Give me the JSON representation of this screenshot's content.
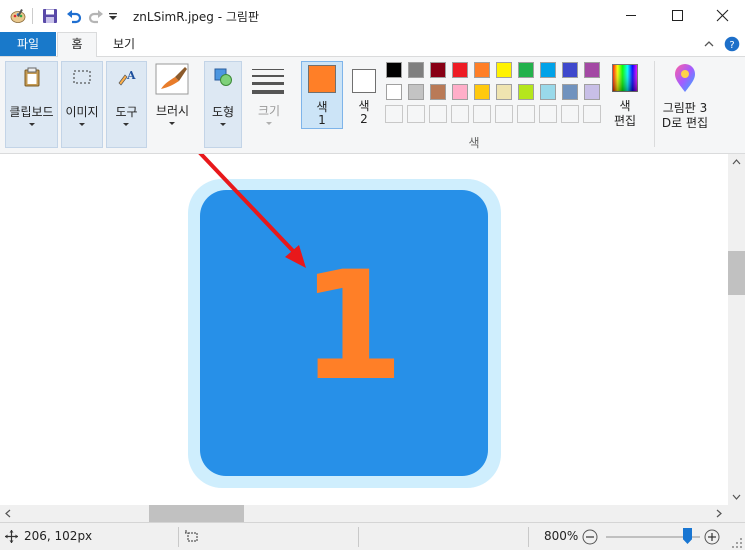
{
  "title_bar": {
    "title": "znLSimR.jpeg - 그림판",
    "icons": [
      "paint-app-icon",
      "save-icon",
      "undo-icon",
      "redo-icon",
      "customize-qat-icon"
    ],
    "window_controls": [
      "minimize-icon",
      "maximize-icon",
      "close-icon"
    ]
  },
  "menu": {
    "file_label": "파일",
    "tabs": [
      {
        "label": "홈",
        "active": true
      },
      {
        "label": "보기",
        "active": false
      }
    ]
  },
  "ribbon": {
    "clipboard_label": "클립보드",
    "image_label": "이미지",
    "tools_label": "도구",
    "brushes_label": "브러시",
    "shapes_label": "도형",
    "size_label": "크기",
    "color1_label": "색",
    "color1_num": "1",
    "color2_label": "색",
    "color2_num": "2",
    "colors_group_label": "색",
    "edit_colors_line1": "색",
    "edit_colors_line2": "편집",
    "paint3d_line1": "그림판 3",
    "paint3d_line2": "D로 편집",
    "color1_value": "#ff7f27",
    "color2_value": "#ffffff",
    "palette_row1": [
      "#000000",
      "#7f7f7f",
      "#880015",
      "#ed1c24",
      "#ff7f27",
      "#fff200",
      "#22b14c",
      "#00a2e8",
      "#3f48cc",
      "#a349a4"
    ],
    "palette_row2": [
      "#ffffff",
      "#c3c3c3",
      "#b97a57",
      "#ffaec9",
      "#ffc90e",
      "#efe4b0",
      "#b5e61d",
      "#99d9ea",
      "#7092be",
      "#c8bfe7"
    ]
  },
  "canvas": {
    "image_bg": "#2790e8",
    "glyph_color": "#ff7f27",
    "glyph_text": "1",
    "arrow_color": "#e8181b"
  },
  "status": {
    "cursor_pos": "206, 102px",
    "zoom": "800%"
  }
}
